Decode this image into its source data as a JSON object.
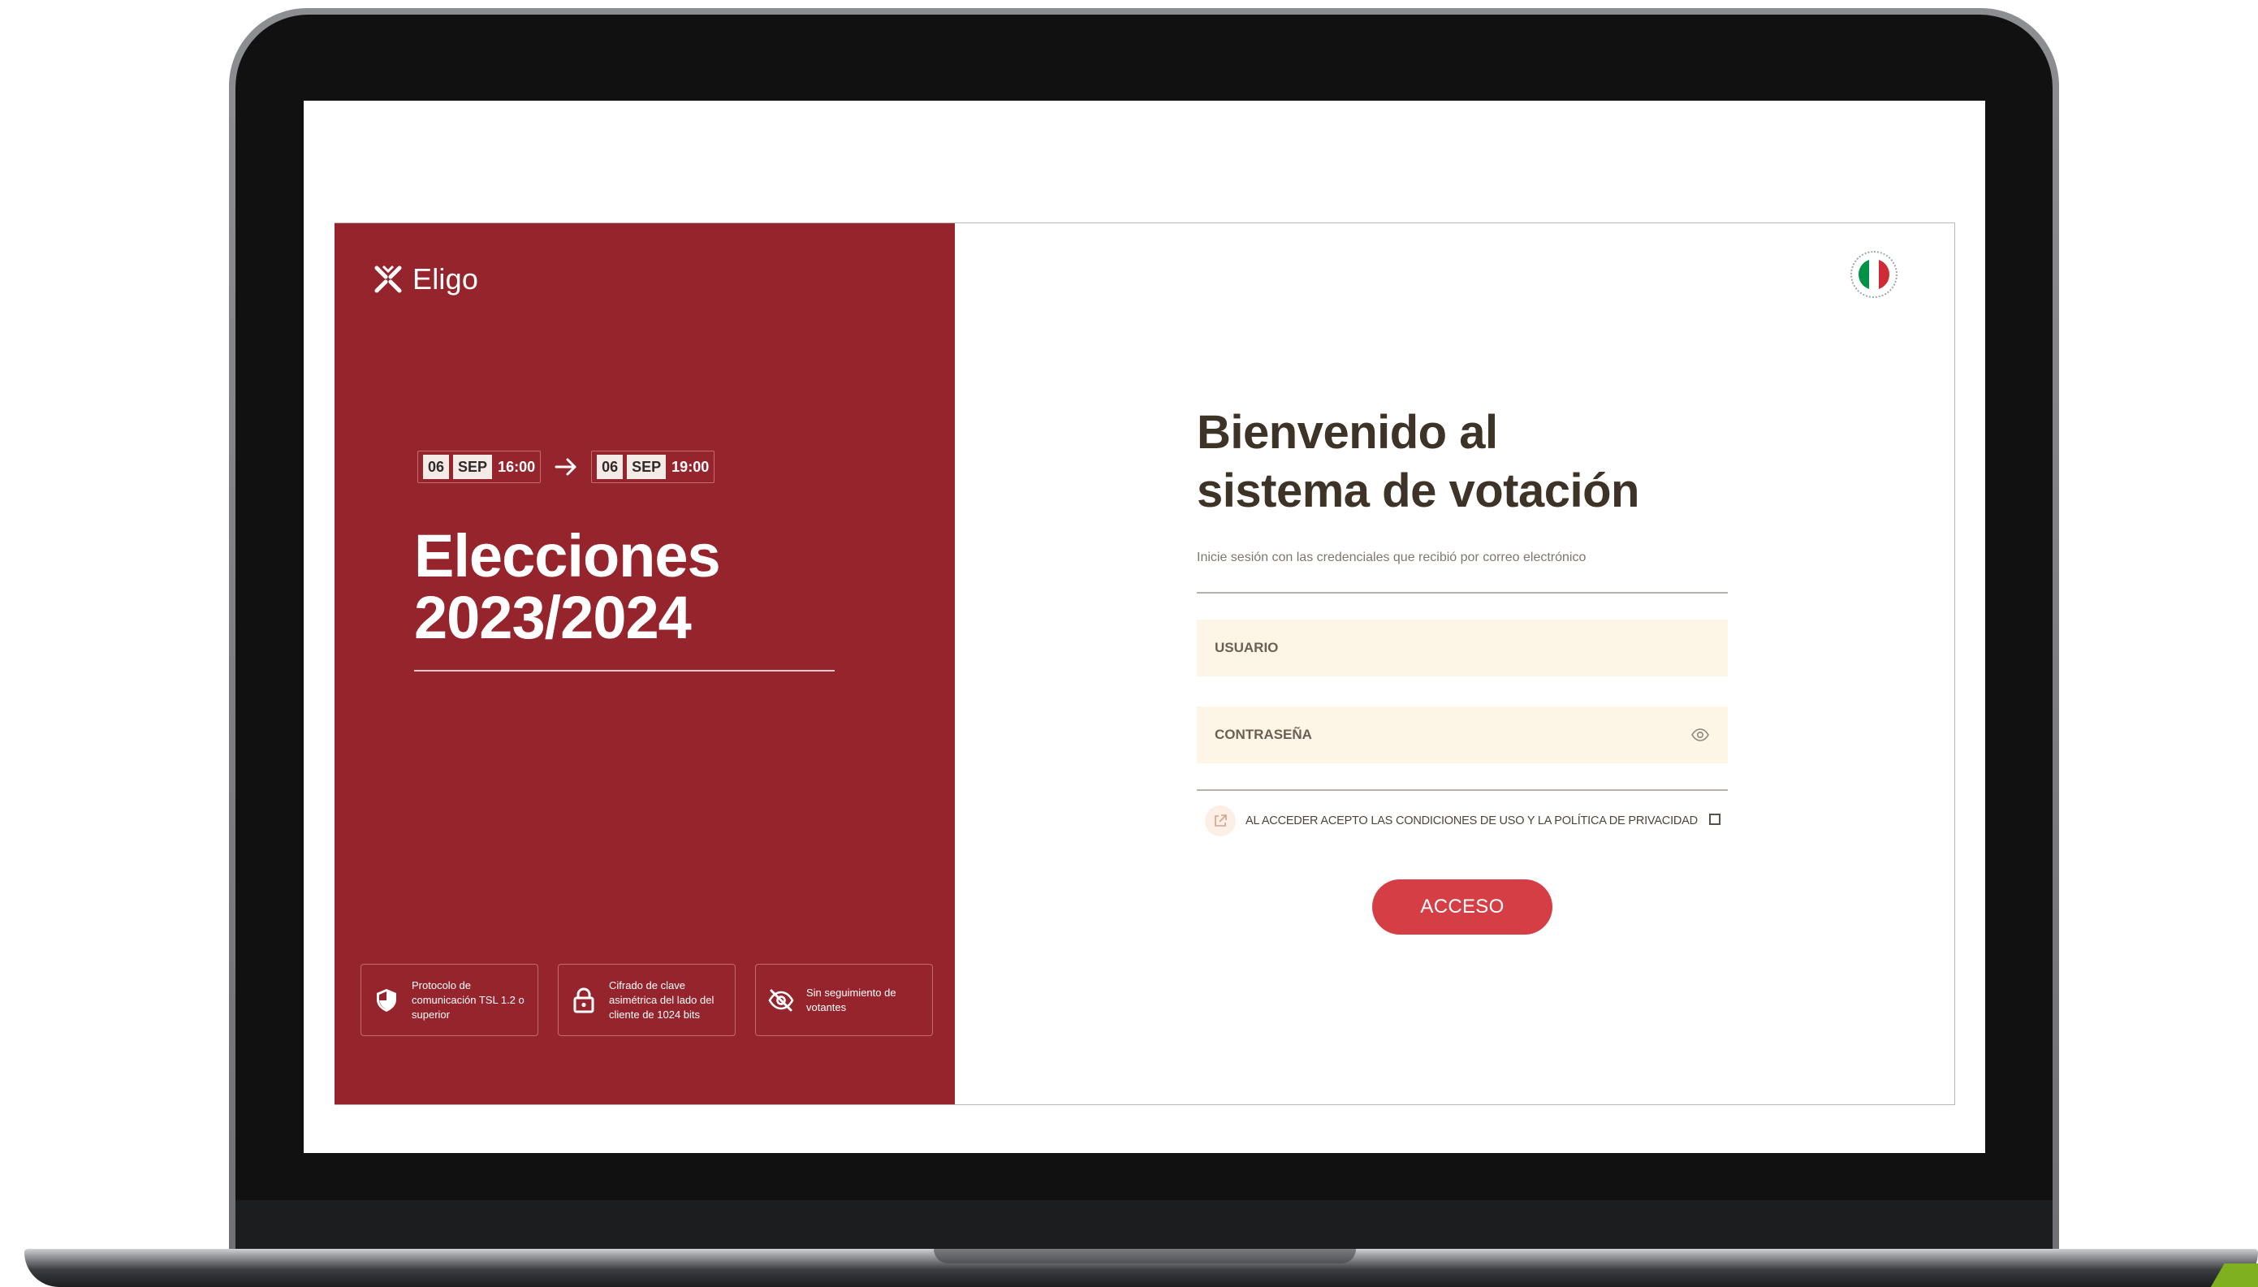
{
  "brand": {
    "name": "Eligo"
  },
  "election": {
    "start": {
      "day": "06",
      "month": "SEP",
      "time": "16:00"
    },
    "end": {
      "day": "06",
      "month": "SEP",
      "time": "19:00"
    },
    "title_line1": "Elecciones",
    "title_line2": "2023/2024"
  },
  "features": [
    {
      "icon": "shield-icon",
      "text": "Protocolo de comunicación TSL 1.2 o superior"
    },
    {
      "icon": "lock-icon",
      "text": "Cifrado de clave asimétrica del lado del cliente de 1024 bits"
    },
    {
      "icon": "eye-off-icon",
      "text": "Sin seguimiento de votantes"
    }
  ],
  "language": {
    "icon": "italian-flag-icon",
    "colors": [
      "#009246",
      "#ffffff",
      "#ce2b37"
    ]
  },
  "login": {
    "title_line1": "Bienvenido al",
    "title_line2": "sistema de votación",
    "subtitle": "Inicie sesión con las credenciales que recibió por correo electrónico",
    "username_placeholder": "USUARIO",
    "password_placeholder": "CONTRASEÑA",
    "terms_prefix": "AL ACCEDER  ACEPTO  LAS CONDICIONES DE USO Y LA POLÍTICA DE PRIVACIDAD",
    "submit_label": "ACCESO"
  },
  "colors": {
    "panel_red": "#96242c",
    "accent_red": "#d63e45",
    "field_bg": "#fdf5e5",
    "heading": "#3d3327"
  }
}
